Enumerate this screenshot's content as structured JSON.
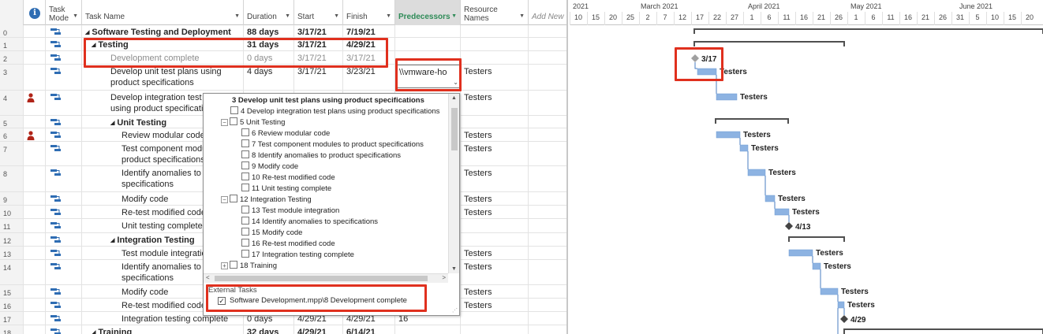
{
  "columns": {
    "task_mode": "Task Mode",
    "task_name": "Task Name",
    "duration": "Duration",
    "start": "Start",
    "finish": "Finish",
    "predecessors": "Predecessors",
    "resource_names": "Resource Names",
    "add_new": "Add New C",
    "info": "i"
  },
  "rows": [
    {
      "id": "0",
      "name": "Software Testing and Deployment",
      "duration": "88 days",
      "start": "3/17/21",
      "finish": "7/19/21",
      "pred": "",
      "res": "",
      "level": 0,
      "summary": true,
      "bold": true,
      "grey": false,
      "person": false
    },
    {
      "id": "1",
      "name": "Testing",
      "duration": "31 days",
      "start": "3/17/21",
      "finish": "4/29/21",
      "pred": "",
      "res": "",
      "level": 1,
      "summary": true,
      "bold": true,
      "grey": false,
      "person": false
    },
    {
      "id": "2",
      "name": "Development complete",
      "duration": "0 days",
      "start": "3/17/21",
      "finish": "3/17/21",
      "pred": "",
      "res": "",
      "level": 2,
      "summary": false,
      "bold": false,
      "grey": true,
      "person": false
    },
    {
      "id": "3",
      "name": "Develop unit test plans using product specifications",
      "duration": "4 days",
      "start": "3/17/21",
      "finish": "3/23/21",
      "pred": "",
      "res": "Testers",
      "level": 2,
      "summary": false,
      "bold": false,
      "grey": false,
      "person": false
    },
    {
      "id": "4",
      "name": "Develop integration test plans using product specifications",
      "duration": "",
      "start": "",
      "finish": "",
      "pred": "",
      "res": "Testers",
      "level": 2,
      "summary": false,
      "bold": false,
      "grey": false,
      "person": true
    },
    {
      "id": "5",
      "name": "Unit Testing",
      "duration": "",
      "start": "",
      "finish": "",
      "pred": "",
      "res": "",
      "level": 2,
      "summary": true,
      "bold": true,
      "grey": false,
      "person": false
    },
    {
      "id": "6",
      "name": "Review modular code",
      "duration": "",
      "start": "",
      "finish": "",
      "pred": "",
      "res": "Testers",
      "level": 3,
      "summary": false,
      "bold": false,
      "grey": false,
      "person": true
    },
    {
      "id": "7",
      "name": "Test component modules to product specifications",
      "duration": "",
      "start": "",
      "finish": "",
      "pred": "",
      "res": "Testers",
      "level": 3,
      "summary": false,
      "bold": false,
      "grey": false,
      "person": false
    },
    {
      "id": "8",
      "name": "Identify anomalies to product specifications",
      "duration": "",
      "start": "",
      "finish": "",
      "pred": "",
      "res": "Testers",
      "level": 3,
      "summary": false,
      "bold": false,
      "grey": false,
      "person": false
    },
    {
      "id": "9",
      "name": "Modify code",
      "duration": "",
      "start": "",
      "finish": "",
      "pred": "",
      "res": "Testers",
      "level": 3,
      "summary": false,
      "bold": false,
      "grey": false,
      "person": false
    },
    {
      "id": "10",
      "name": "Re-test modified code",
      "duration": "",
      "start": "",
      "finish": "",
      "pred": "",
      "res": "Testers",
      "level": 3,
      "summary": false,
      "bold": false,
      "grey": false,
      "person": false
    },
    {
      "id": "11",
      "name": "Unit testing complete",
      "duration": "",
      "start": "",
      "finish": "",
      "pred": "",
      "res": "",
      "level": 3,
      "summary": false,
      "bold": false,
      "grey": false,
      "person": false
    },
    {
      "id": "12",
      "name": "Integration Testing",
      "duration": "",
      "start": "",
      "finish": "",
      "pred": "",
      "res": "",
      "level": 2,
      "summary": true,
      "bold": true,
      "grey": false,
      "person": false
    },
    {
      "id": "13",
      "name": "Test module integration",
      "duration": "",
      "start": "",
      "finish": "",
      "pred": "",
      "res": "Testers",
      "level": 3,
      "summary": false,
      "bold": false,
      "grey": false,
      "person": false
    },
    {
      "id": "14",
      "name": "Identify anomalies to specifications",
      "duration": "",
      "start": "",
      "finish": "",
      "pred": "",
      "res": "Testers",
      "level": 3,
      "summary": false,
      "bold": false,
      "grey": false,
      "person": false
    },
    {
      "id": "15",
      "name": "Modify code",
      "duration": "",
      "start": "",
      "finish": "",
      "pred": "",
      "res": "Testers",
      "level": 3,
      "summary": false,
      "bold": false,
      "grey": false,
      "person": false
    },
    {
      "id": "16",
      "name": "Re-test modified code",
      "duration": "",
      "start": "",
      "finish": "",
      "pred": "",
      "res": "Testers",
      "level": 3,
      "summary": false,
      "bold": false,
      "grey": false,
      "person": false
    },
    {
      "id": "17",
      "name": "Integration testing complete",
      "duration": "0 days",
      "start": "4/29/21",
      "finish": "4/29/21",
      "pred": "16",
      "res": "",
      "level": 3,
      "summary": false,
      "bold": false,
      "grey": false,
      "person": false
    },
    {
      "id": "18",
      "name": "Training",
      "duration": "32 days",
      "start": "4/29/21",
      "finish": "6/14/21",
      "pred": "",
      "res": "",
      "level": 1,
      "summary": true,
      "bold": true,
      "grey": false,
      "person": false
    }
  ],
  "pred_editor": {
    "value": "\\\\vmware-ho"
  },
  "popup": {
    "items": [
      {
        "label": "3  Develop unit test plans using product specifications",
        "indent": 0,
        "current": true,
        "box": false,
        "exp": ""
      },
      {
        "label": "4  Develop integration test plans using product specifications",
        "indent": 0,
        "current": false,
        "box": true,
        "exp": ""
      },
      {
        "label": "5  Unit Testing",
        "indent": 0,
        "current": false,
        "box": true,
        "exp": "−"
      },
      {
        "label": "6  Review modular code",
        "indent": 1,
        "current": false,
        "box": true,
        "exp": ""
      },
      {
        "label": "7  Test component modules to product specifications",
        "indent": 1,
        "current": false,
        "box": true,
        "exp": ""
      },
      {
        "label": "8  Identify anomalies to product specifications",
        "indent": 1,
        "current": false,
        "box": true,
        "exp": ""
      },
      {
        "label": "9  Modify code",
        "indent": 1,
        "current": false,
        "box": true,
        "exp": ""
      },
      {
        "label": "10  Re-test modified code",
        "indent": 1,
        "current": false,
        "box": true,
        "exp": ""
      },
      {
        "label": "11  Unit testing complete",
        "indent": 1,
        "current": false,
        "box": true,
        "exp": ""
      },
      {
        "label": "12  Integration Testing",
        "indent": 0,
        "current": false,
        "box": true,
        "exp": "−"
      },
      {
        "label": "13  Test module integration",
        "indent": 1,
        "current": false,
        "box": true,
        "exp": ""
      },
      {
        "label": "14  Identify anomalies to specifications",
        "indent": 1,
        "current": false,
        "box": true,
        "exp": ""
      },
      {
        "label": "15  Modify code",
        "indent": 1,
        "current": false,
        "box": true,
        "exp": ""
      },
      {
        "label": "16  Re-test modified code",
        "indent": 1,
        "current": false,
        "box": true,
        "exp": ""
      },
      {
        "label": "17  Integration testing complete",
        "indent": 1,
        "current": false,
        "box": true,
        "exp": ""
      },
      {
        "label": "18  Training",
        "indent": 0,
        "current": false,
        "box": true,
        "exp": "+"
      }
    ],
    "external_label": "External Tasks",
    "external_item": "Software Development.mpp\\8  Development complete",
    "external_checked": true
  },
  "timeline": {
    "months": [
      "2021",
      "March 2021",
      "April 2021",
      "May 2021",
      "June 2021"
    ],
    "days": [
      "10",
      "15",
      "20",
      "25",
      "2",
      "7",
      "12",
      "17",
      "22",
      "27",
      "1",
      "6",
      "11",
      "16",
      "21",
      "26",
      "1",
      "6",
      "11",
      "16",
      "21",
      "26",
      "31",
      "5",
      "10",
      "15",
      "20"
    ]
  },
  "gantt_labels": {
    "milestone_row2": "3/17",
    "milestone_row11": "4/13",
    "milestone_row17": "4/29",
    "resource": "Testers"
  },
  "colors": {
    "bar": "#8db3e2",
    "summary": "#505050",
    "highlight": "#e0301e",
    "predecessor_header": "#2e8b57"
  }
}
